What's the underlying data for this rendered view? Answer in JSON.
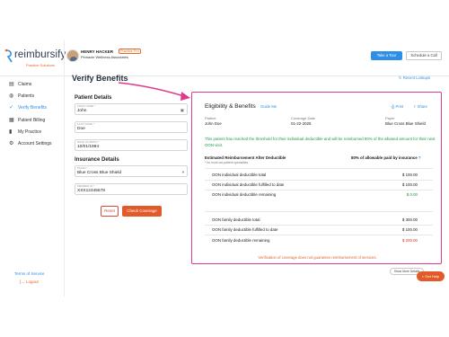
{
  "app": {
    "logo_text": "reimbursify",
    "logo_sub": "Practice Solutions"
  },
  "user": {
    "name": "HENRY HACKER",
    "badge": "Practice Pro",
    "practice": "Pinnacle Wellness Associates"
  },
  "header": {
    "tour_label": "Take a Tour",
    "call_label": "Schedule a Call"
  },
  "sidebar": {
    "items": [
      {
        "label": "Claims",
        "icon": "claims-icon"
      },
      {
        "label": "Patients",
        "icon": "patients-icon"
      },
      {
        "label": "Verify Benefits",
        "icon": "verify-benefits-icon",
        "active": true
      },
      {
        "label": "Patient Billing",
        "icon": "billing-icon"
      },
      {
        "label": "My Practice",
        "icon": "practice-icon"
      },
      {
        "label": "Account Settings",
        "icon": "settings-icon"
      }
    ],
    "terms": "Terms of Service",
    "logout": "Logout"
  },
  "main": {
    "title": "Verify Benefits",
    "recent_lookups": "Recent Lookups",
    "patient_details": {
      "heading": "Patient Details",
      "first_name_label": "FIRST NAME *",
      "first_name": "John",
      "last_name_label": "LAST NAME *",
      "last_name": "Doe",
      "dob_label": "DATE OF BIRTH *",
      "dob": "10/01/1984"
    },
    "insurance_details": {
      "heading": "Insurance Details",
      "payer_label": "PAYER *",
      "payer": "Blue Cross Blue Shield",
      "member_label": "MEMBER ID *",
      "member_id": "XXX12345678"
    },
    "reset_label": "Reset",
    "check_label": "Check Coverage"
  },
  "eligibility": {
    "title": "Eligibility & Benefits",
    "guide": "Guide Me",
    "print": "Print",
    "share": "Share",
    "patient_label": "Patient",
    "patient_value": "John Doe",
    "coverage_label": "Coverage Date",
    "coverage_value": "01-22-2025",
    "payer_label": "Payer",
    "payer_value": "Blue Cross Blue Shield",
    "notice": "This patient has reached the threshold for their individual deductible and will be reimbursed 80% of the allowed amount for their next OON visit.",
    "est_title": "Estimated Reimbursement After Deductible",
    "est_sub": "* for most out-patient specialties",
    "pct_label": "80% of allowable paid by insurance",
    "individual": [
      {
        "label": "OON individual deductible total",
        "value": "$ 100.00"
      },
      {
        "label": "OON individual deductible fulfilled to date",
        "value": "$ 100.00"
      },
      {
        "label": "OON individual deductible remaining",
        "value": "$ 0.00"
      }
    ],
    "family": [
      {
        "label": "OON family deductible total",
        "value": "$ 300.00"
      },
      {
        "label": "OON family deductible fulfilled to date",
        "value": "$ 100.00"
      },
      {
        "label": "OON family deductible remaining",
        "value": "$ 200.00"
      }
    ],
    "disclaimer": "Verification of coverage does not guarantee reimbursement of services."
  },
  "view_more": "Show More Details",
  "help": "Get Help",
  "colors": {
    "accent": "#2e8fe6",
    "brand_orange": "#e35a2a",
    "highlight_pink": "#e03a8c",
    "success": "#1f9a4b",
    "danger": "#d7322a"
  }
}
